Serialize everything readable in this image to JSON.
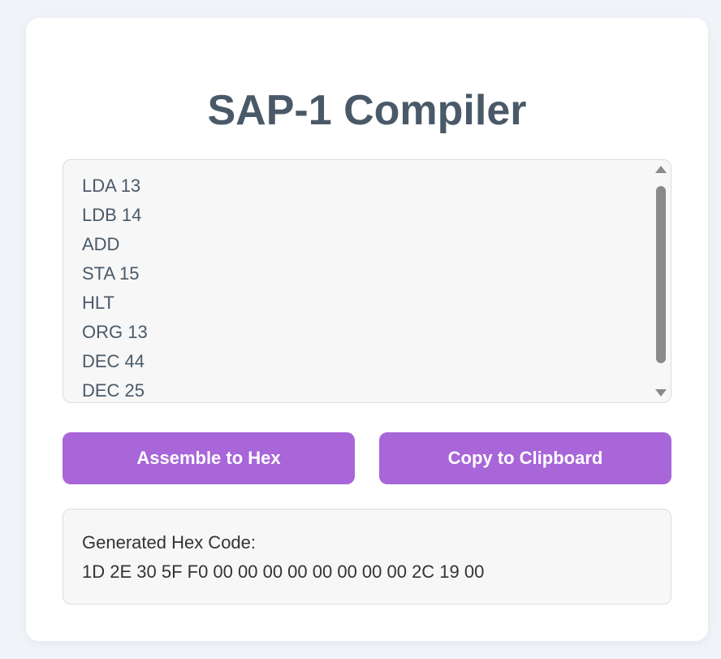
{
  "title": "SAP-1 Compiler",
  "editor": {
    "lines": [
      "LDA 13",
      "LDB 14",
      "ADD",
      "STA 15",
      "HLT",
      "ORG 13",
      "DEC 44",
      "DEC 25"
    ]
  },
  "buttons": {
    "assemble_label": "Assemble to Hex",
    "copy_label": "Copy to Clipboard"
  },
  "output": {
    "label": "Generated Hex Code:",
    "hex": "1D 2E 30 5F F0 00 00 00 00 00 00 00 00 2C 19 00"
  },
  "colors": {
    "accent": "#a866d9",
    "title": "#4a5968",
    "background": "#f0f3f8"
  }
}
